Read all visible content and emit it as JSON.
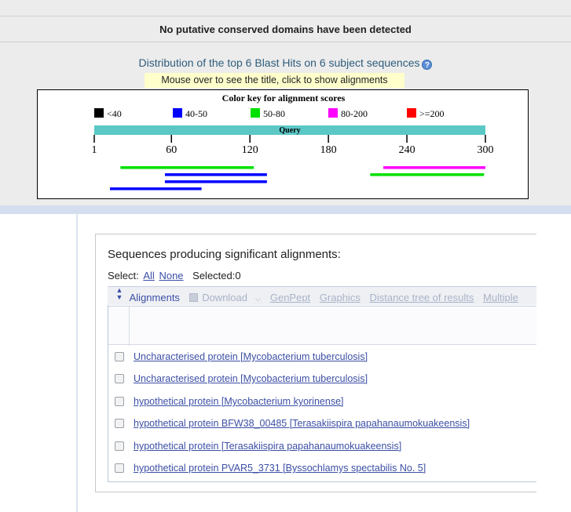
{
  "cdd": {
    "message": "No putative conserved domains have been detected"
  },
  "distribution": {
    "title": "Distribution of the top 6 Blast Hits on 6 subject sequences",
    "help_icon": "help-icon",
    "mouse_over": "Mouse over to see the title, click to show alignments",
    "color_key_title": "Color key for alignment scores",
    "color_key": [
      {
        "label": "<40",
        "color": "#000000"
      },
      {
        "label": "40-50",
        "color": "#0000ff"
      },
      {
        "label": "50-80",
        "color": "#00e000"
      },
      {
        "label": "80-200",
        "color": "#ff00ff"
      },
      {
        "label": ">=200",
        "color": "#ff0000"
      }
    ],
    "query_label": "Query",
    "query_bar_color": "#5bc8c6",
    "axis": {
      "min": 1,
      "max": 300,
      "ticks": [
        "1",
        "60",
        "120",
        "180",
        "240",
        "300"
      ],
      "tick_values": [
        1,
        60,
        120,
        180,
        240,
        300
      ]
    },
    "hits": [
      {
        "segments": [
          {
            "start": 21,
            "end": 123,
            "color": "#00e000"
          },
          {
            "start": 222,
            "end": 300,
            "color": "#ff00ff"
          }
        ]
      },
      {
        "segments": [
          {
            "start": 55,
            "end": 133,
            "color": "#0000ff"
          },
          {
            "start": 212,
            "end": 299,
            "color": "#00e000"
          }
        ]
      },
      {
        "segments": [
          {
            "start": 55,
            "end": 133,
            "color": "#0000ff"
          }
        ]
      },
      {
        "segments": [
          {
            "start": 13,
            "end": 83,
            "color": "#0000ff"
          }
        ]
      }
    ]
  },
  "results": {
    "title": "Sequences producing significant alignments:",
    "select_label": "Select:",
    "select_all": "All",
    "select_none": "None",
    "selected": "Selected:0",
    "toolbar": {
      "alignments": "Alignments",
      "download": "Download",
      "genpept": "GenPept",
      "graphics": "Graphics",
      "distance_tree": "Distance tree of results",
      "multiple": "Multiple"
    },
    "rows": [
      "Uncharacterised protein [Mycobacterium tuberculosis]",
      "Uncharacterised protein [Mycobacterium tuberculosis]",
      "hypothetical protein [Mycobacterium kyorinense]",
      "hypothetical protein BFW38_00485 [Terasakiispira papahanaumokuakeensis]",
      "hypothetical protein [Terasakiispira papahanaumokuakeensis]",
      "hypothetical protein PVAR5_3731 [Byssochlamys spectabilis No. 5]"
    ]
  }
}
